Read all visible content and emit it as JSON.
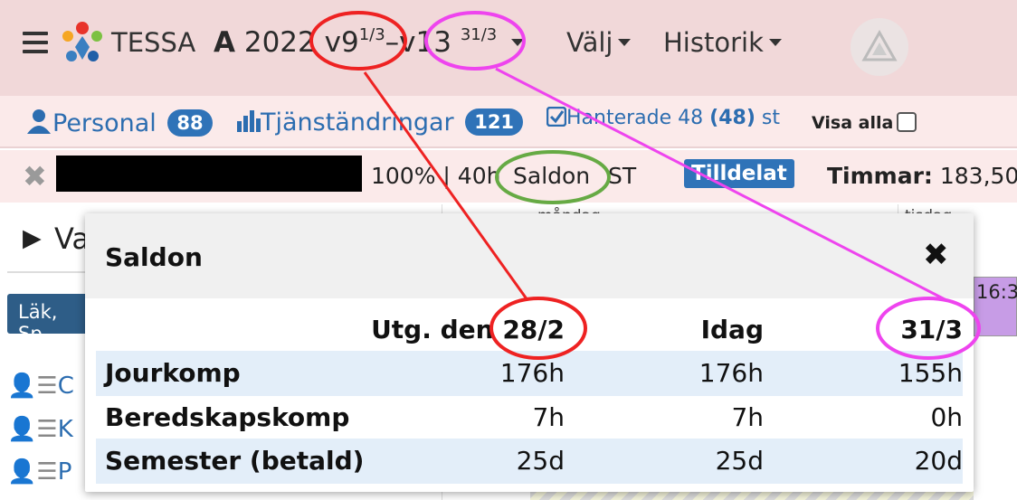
{
  "header": {
    "brand": "TESSA",
    "period": {
      "year": "2022",
      "from_week": "v9",
      "from_date": "1/3",
      "dash": "–",
      "to_week": "v13",
      "to_date": "31/3"
    },
    "menus": [
      "Välj",
      "Historik"
    ]
  },
  "stats": {
    "personal_label": "Personal",
    "personal_count": "88",
    "changes_label": "Tjänständringar",
    "changes_count": "121",
    "handled_text": "Hanterade 48",
    "handled_bold": "(48)",
    "handled_suffix": "st",
    "show_all_label": "Visa alla"
  },
  "person": {
    "employment": "100% | 40h",
    "saldon_link": "Saldon",
    "type": "ST",
    "status_tag": "Tilldelat",
    "hours_label": "Timmar:",
    "hours_value": "183,50"
  },
  "background": {
    "section_prefix": "Va",
    "tag": "Läk, Sp",
    "rows": [
      "C",
      "K",
      "P"
    ],
    "col1_header": "måndag",
    "col2_header": "tisdag",
    "time": "16:3"
  },
  "modal": {
    "title": "Saldon",
    "columns": [
      "Utg. den 28/2",
      "Idag",
      "31/3"
    ],
    "rows": [
      {
        "label": "Jourkomp",
        "values": [
          "176h",
          "176h",
          "155h"
        ]
      },
      {
        "label": "Beredskapskomp",
        "values": [
          "7h",
          "7h",
          "0h"
        ]
      },
      {
        "label": "Semester (betald)",
        "values": [
          "25d",
          "25d",
          "20d"
        ]
      }
    ]
  },
  "colors": {
    "header_bg": "#f1d8d9",
    "accent_blue": "#2f73b8",
    "annotation_red": "#ee2222",
    "annotation_magenta": "#ee44ee",
    "annotation_green": "#66aa44"
  }
}
